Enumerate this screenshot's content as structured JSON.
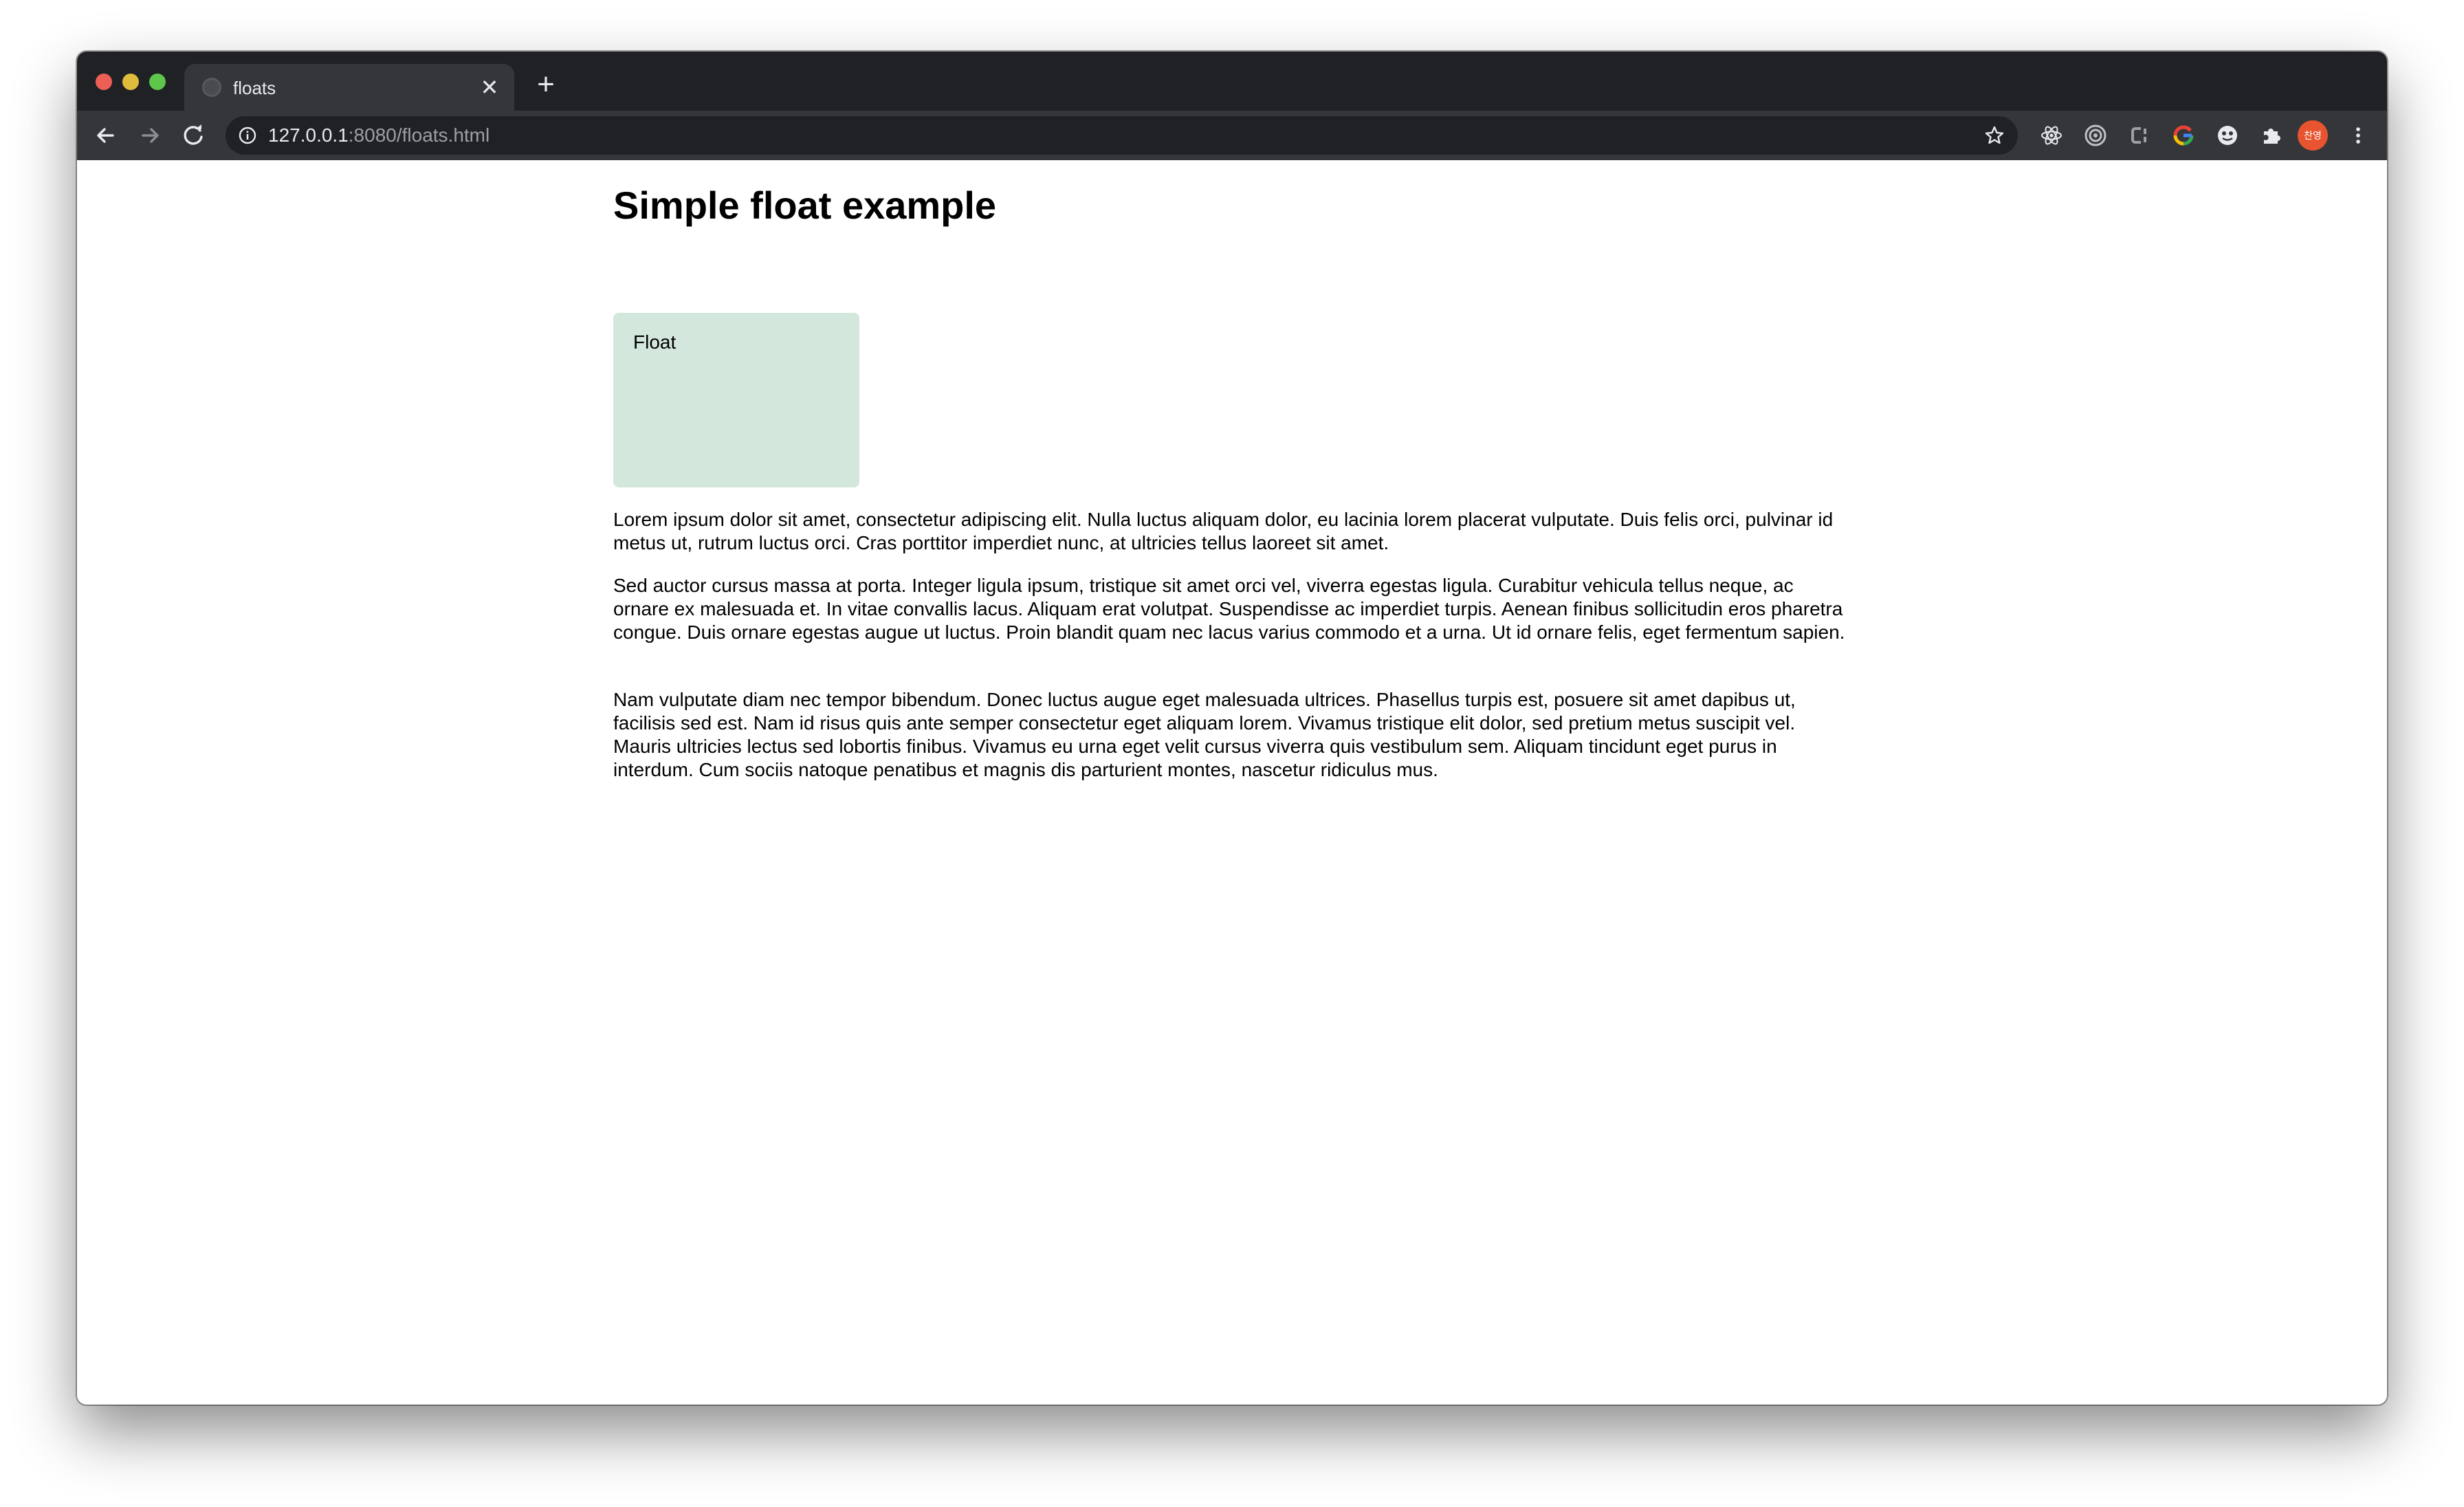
{
  "browser": {
    "tab": {
      "title": "floats",
      "close_glyph": "✕",
      "favicon": "globe-icon"
    },
    "new_tab_glyph": "+",
    "toolbar": {
      "back": "arrow-left-icon",
      "forward": "arrow-right-icon",
      "reload": "reload-icon"
    },
    "address": {
      "host": "127.0.0.1",
      "path": ":8080/floats.html"
    },
    "extensions": [
      "react-icon",
      "target-icon",
      "cs-icon",
      "google-icon",
      "face-icon",
      "puzzle-icon"
    ],
    "avatar_text": "찬영",
    "colors": {
      "tabstrip": "#202124",
      "toolbar": "#35363a",
      "avatar": "#e8542f"
    }
  },
  "page": {
    "heading": "Simple float example",
    "float_label": "Float",
    "float_color": "#d4e7dd",
    "paragraphs": [
      "Lorem ipsum dolor sit amet, consectetur adipiscing elit. Nulla luctus aliquam dolor, eu lacinia lorem placerat vulputate. Duis felis orci, pulvinar id metus ut, rutrum luctus orci. Cras porttitor imperdiet nunc, at ultricies tellus laoreet sit amet.",
      "Sed auctor cursus massa at porta. Integer ligula ipsum, tristique sit amet orci vel, viverra egestas ligula. Curabitur vehicula tellus neque, ac ornare ex malesuada et. In vitae convallis lacus. Aliquam erat volutpat. Suspendisse ac imperdiet turpis. Aenean finibus sollicitudin eros pharetra congue. Duis ornare egestas augue ut luctus. Proin blandit quam nec lacus varius commodo et a urna. Ut id ornare felis, eget fermentum sapien.",
      "Nam vulputate diam nec tempor bibendum. Donec luctus augue eget malesuada ultrices. Phasellus turpis est, posuere sit amet dapibus ut, facilisis sed est. Nam id risus quis ante semper consectetur eget aliquam lorem. Vivamus tristique elit dolor, sed pretium metus suscipit vel. Mauris ultricies lectus sed lobortis finibus. Vivamus eu urna eget velit cursus viverra quis vestibulum sem. Aliquam tincidunt eget purus in interdum. Cum sociis natoque penatibus et magnis dis parturient montes, nascetur ridiculus mus."
    ]
  }
}
